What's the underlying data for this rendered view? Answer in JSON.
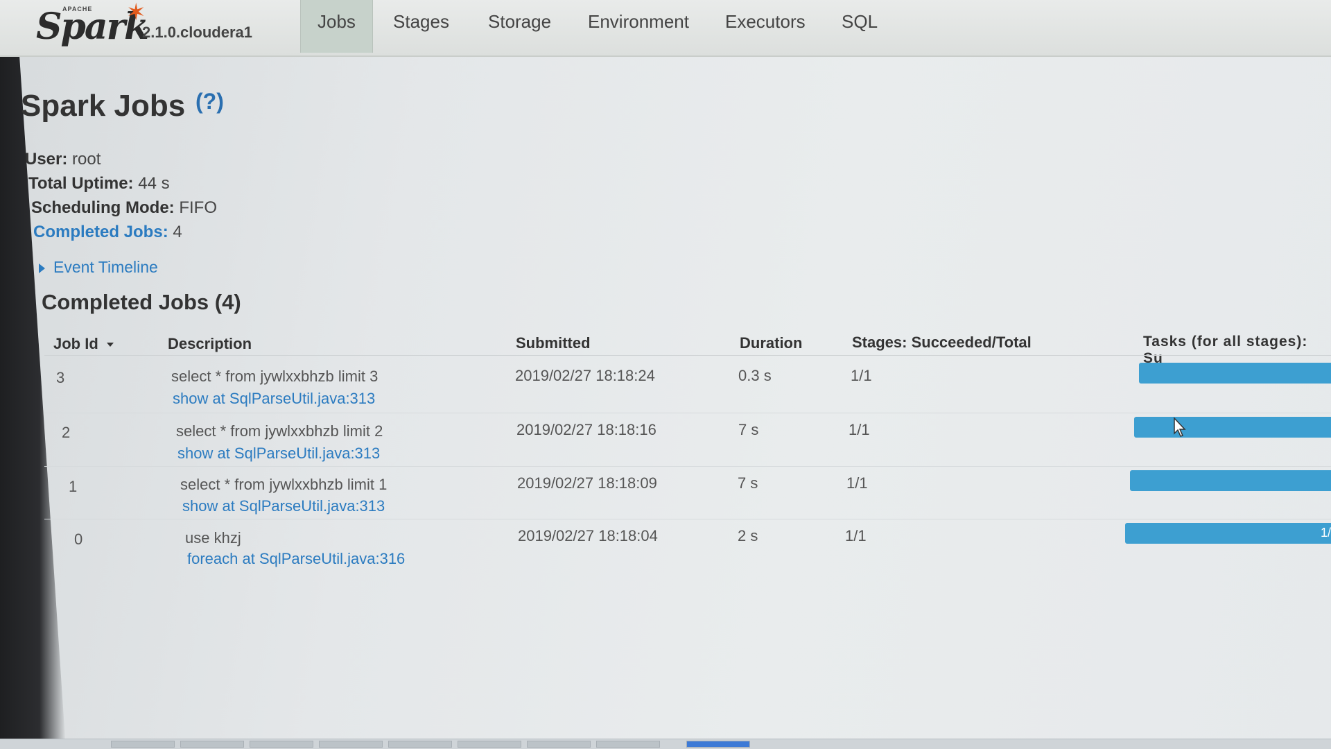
{
  "header": {
    "brand_small": "APACHE",
    "brand": "Spark",
    "version": "2.1.0.cloudera1",
    "tabs": [
      {
        "label": "Jobs",
        "active": true
      },
      {
        "label": "Stages",
        "active": false
      },
      {
        "label": "Storage",
        "active": false
      },
      {
        "label": "Environment",
        "active": false
      },
      {
        "label": "Executors",
        "active": false
      },
      {
        "label": "SQL",
        "active": false
      }
    ]
  },
  "page": {
    "title": "Spark Jobs",
    "help": "(?)"
  },
  "summary": {
    "user_label": "User:",
    "user": "root",
    "uptime_label": "Total Uptime:",
    "uptime": "44 s",
    "mode_label": "Scheduling Mode:",
    "mode": "FIFO",
    "completed_label": "Completed Jobs:",
    "completed": "4"
  },
  "event_timeline": "Event Timeline",
  "completed_section": {
    "title": "Completed Jobs (4)",
    "columns": [
      "Job Id",
      "Description",
      "Submitted",
      "Duration",
      "Stages: Succeeded/Total",
      "Tasks (for all stages): Su"
    ],
    "rows": [
      {
        "id": "3",
        "description": "select * from jywlxxbhzb limit 3",
        "call_site": "show at SqlParseUtil.java:313",
        "submitted": "2019/02/27 18:18:24",
        "duration": "0.3 s",
        "stages": "1/1",
        "tasks_progress": 1.0,
        "tasks_label": ""
      },
      {
        "id": "2",
        "description": "select * from jywlxxbhzb limit 2",
        "call_site": "show at SqlParseUtil.java:313",
        "submitted": "2019/02/27 18:18:16",
        "duration": "7 s",
        "stages": "1/1",
        "tasks_progress": 1.0,
        "tasks_label": ""
      },
      {
        "id": "1",
        "description": "select * from jywlxxbhzb limit 1",
        "call_site": "show at SqlParseUtil.java:313",
        "submitted": "2019/02/27 18:18:09",
        "duration": "7 s",
        "stages": "1/1",
        "tasks_progress": 1.0,
        "tasks_label": ""
      },
      {
        "id": "0",
        "description": "use khzj",
        "call_site": "foreach at SqlParseUtil.java:316",
        "submitted": "2019/02/27 18:18:04",
        "duration": "2 s",
        "stages": "1/1",
        "tasks_progress": 1.0,
        "tasks_label": "1/"
      }
    ]
  },
  "colors": {
    "link": "#2b7bc0",
    "progress": "#3d9fd1",
    "active_tab": "#c7d2cb",
    "spark_orange": "#e25a1c"
  }
}
